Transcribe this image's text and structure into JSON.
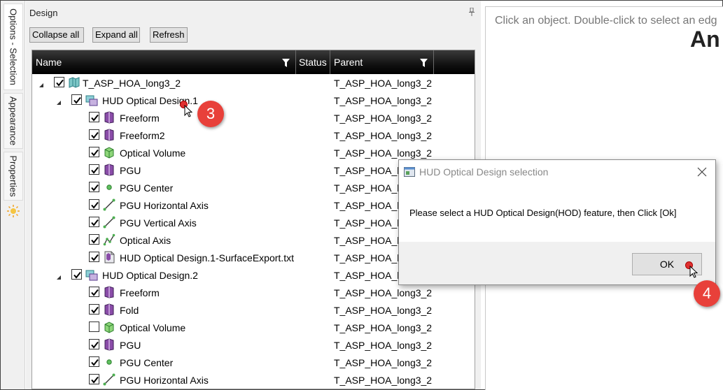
{
  "side_tabs": [
    {
      "label": "Options - Selection"
    },
    {
      "label": "Appearance"
    },
    {
      "label": "Properties"
    }
  ],
  "panel": {
    "title": "Design",
    "buttons": {
      "collapse_all": "Collapse all",
      "expand_all": "Expand all",
      "refresh": "Refresh"
    },
    "columns": {
      "name": "Name",
      "status": "Status",
      "parent": "Parent"
    }
  },
  "tree": {
    "rows": [
      {
        "label": "T_ASP_HOA_long3_2",
        "parent": "T_ASP_HOA_long3_2",
        "checked": true,
        "icon": "part-icon",
        "level": 0,
        "expander": true
      },
      {
        "label": "HUD Optical Design.1",
        "parent": "T_ASP_HOA_long3_2",
        "checked": true,
        "icon": "hud-design-icon",
        "level": 1,
        "expander": true
      },
      {
        "label": "Freeform",
        "parent": "T_ASP_HOA_long3_2",
        "checked": true,
        "icon": "freeform-icon",
        "level": 2
      },
      {
        "label": "Freeform2",
        "parent": "T_ASP_HOA_long3_2",
        "checked": true,
        "icon": "freeform-icon",
        "level": 2
      },
      {
        "label": "Optical Volume",
        "parent": "T_ASP_HOA_long3_2",
        "checked": true,
        "icon": "volume-icon",
        "level": 2
      },
      {
        "label": "PGU",
        "parent": "T_ASP_HOA_lo",
        "checked": true,
        "icon": "freeform-icon",
        "level": 2
      },
      {
        "label": "PGU Center",
        "parent": "T_ASP_HOA_lo",
        "checked": true,
        "icon": "point-icon",
        "level": 2
      },
      {
        "label": "PGU Horizontal Axis",
        "parent": "T_ASP_HOA_lo",
        "checked": true,
        "icon": "axis-icon",
        "level": 2
      },
      {
        "label": "PGU Vertical Axis",
        "parent": "T_ASP_HOA_lo",
        "checked": true,
        "icon": "axis-icon",
        "level": 2
      },
      {
        "label": "Optical Axis",
        "parent": "T_ASP_HOA_lo",
        "checked": true,
        "icon": "optical-axis-icon",
        "level": 2
      },
      {
        "label": "HUD Optical Design.1-SurfaceExport.txt",
        "parent": "T_ASP_HOA_lo",
        "checked": true,
        "icon": "file-icon",
        "level": 2
      },
      {
        "label": "HUD Optical Design.2",
        "parent": "T_ASP_HOA_lo",
        "checked": true,
        "icon": "hud-design-icon",
        "level": 1,
        "expander": true
      },
      {
        "label": "Freeform",
        "parent": "T_ASP_HOA_long3_2",
        "checked": true,
        "icon": "freeform-icon",
        "level": 2
      },
      {
        "label": "Fold",
        "parent": "T_ASP_HOA_long3_2",
        "checked": true,
        "icon": "freeform-icon",
        "level": 2
      },
      {
        "label": "Optical Volume",
        "parent": "T_ASP_HOA_long3_2",
        "checked": false,
        "icon": "volume-icon",
        "level": 2
      },
      {
        "label": "PGU",
        "parent": "T_ASP_HOA_long3_2",
        "checked": true,
        "icon": "freeform-icon",
        "level": 2
      },
      {
        "label": "PGU Center",
        "parent": "T_ASP_HOA_long3_2",
        "checked": true,
        "icon": "point-icon",
        "level": 2
      },
      {
        "label": "PGU Horizontal Axis",
        "parent": "T_ASP_HOA_long3_2",
        "checked": true,
        "icon": "axis-icon",
        "level": 2
      }
    ]
  },
  "viewport": {
    "hint": "Click an object. Double-click to select an edg",
    "logo_text": "An"
  },
  "dialog": {
    "title": "HUD Optical Design selection",
    "message": "Please select a HUD Optical Design(HOD) feature, then Click [Ok]",
    "ok_label": "OK"
  },
  "steps": {
    "step3": "3",
    "step4": "4"
  },
  "colors": {
    "accent_red": "#e8403a",
    "header_black": "#111111",
    "icon_purple": "#7a3e8e",
    "icon_green": "#4caf50"
  }
}
